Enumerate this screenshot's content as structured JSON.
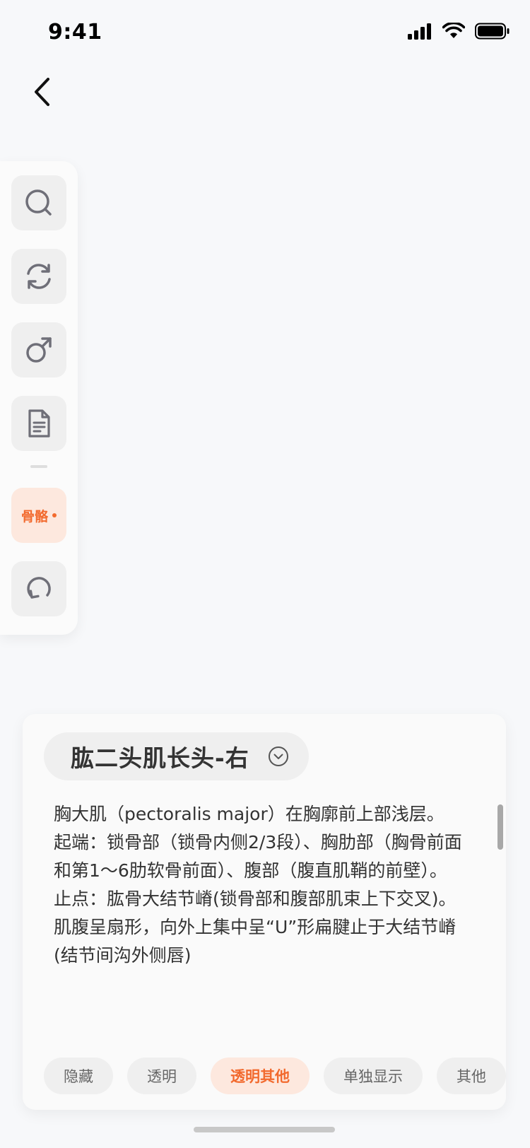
{
  "status_bar": {
    "time": "9:41"
  },
  "toolbar": {
    "buttons": [
      {
        "icon": "search-icon"
      },
      {
        "icon": "rotate-icon"
      },
      {
        "icon": "male-icon"
      },
      {
        "icon": "document-icon"
      }
    ],
    "layer_label": "骨骼",
    "reset_icon": "reset-icon"
  },
  "card": {
    "title": "肱二头肌长头-右",
    "description": [
      "胸大肌（pectoralis major）在胸廓前上部浅层。",
      "起端：锁骨部（锁骨内侧2/3段）、胸肋部（胸骨前面和第1～6肋软骨前面）、腹部（腹直肌鞘的前壁）。",
      "止点：肱骨大结节嵴(锁骨部和腹部肌束上下交叉)。",
      "肌腹呈扇形，向外上集中呈“U”形扁腱止于大结节嵴(结节间沟外侧唇)"
    ],
    "actions": [
      "隐藏",
      "透明",
      "透明其他",
      "单独显示",
      "其他"
    ],
    "selected_action": "透明其他"
  },
  "colors": {
    "accent": "#f26a2e",
    "accent_bg": "#fde8de"
  }
}
